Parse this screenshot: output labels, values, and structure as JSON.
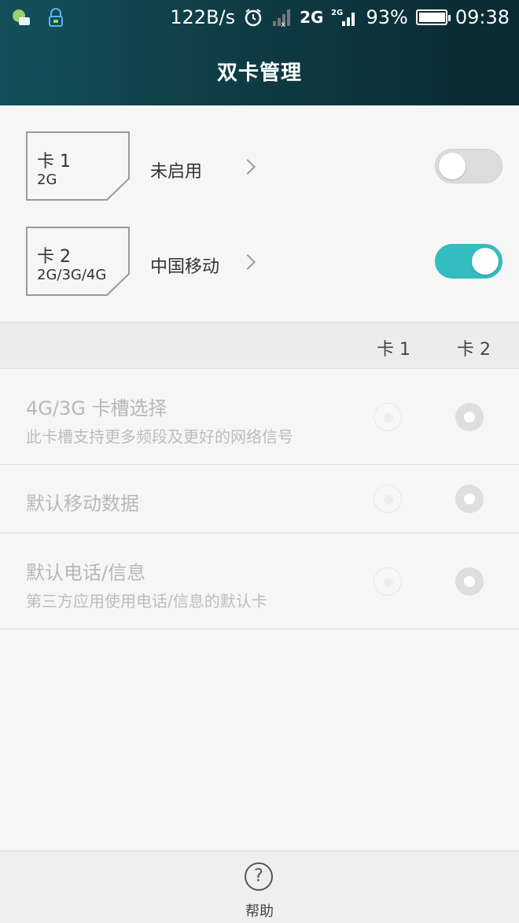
{
  "status_bar": {
    "net_speed": "122B/s",
    "net_type_1": "2G",
    "net_type_2": "2G",
    "battery": "93%",
    "battery_level": 0.93,
    "time": "09:38"
  },
  "header": {
    "title": "双卡管理"
  },
  "sims": [
    {
      "name": "卡 1",
      "network": "2G",
      "operator": "未启用",
      "enabled": false
    },
    {
      "name": "卡 2",
      "network": "2G/3G/4G",
      "operator": "中国移动",
      "enabled": true
    }
  ],
  "columns": {
    "card1": "卡 1",
    "card2": "卡 2"
  },
  "settings": [
    {
      "title": "4G/3G 卡槽选择",
      "subtitle": "此卡槽支持更多频段及更好的网络信号",
      "selected": "card2"
    },
    {
      "title": "默认移动数据",
      "subtitle": "",
      "selected": "card2"
    },
    {
      "title": "默认电话/信息",
      "subtitle": "第三方应用使用电话/信息的默认卡",
      "selected": "card2"
    }
  ],
  "bottom": {
    "help_label": "帮助"
  },
  "colors": {
    "accent": "#34bcbf",
    "header_start": "#14505a",
    "header_end": "#0a2a31"
  }
}
